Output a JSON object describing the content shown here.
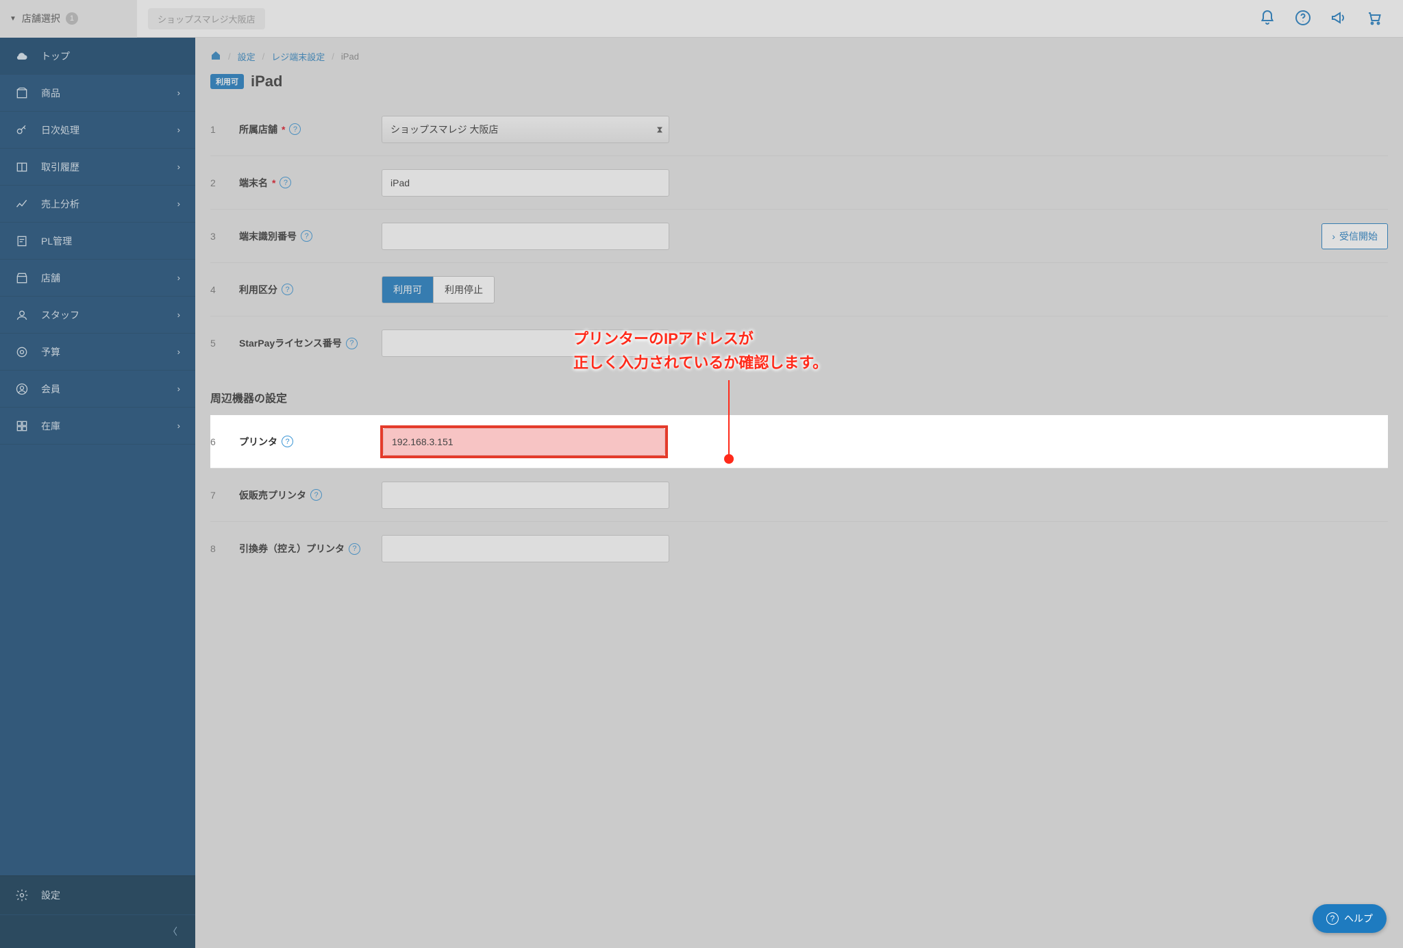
{
  "topbar": {
    "store_selector_label": "店舗選択",
    "store_count": "1",
    "store_name": "ショップスマレジ大阪店"
  },
  "breadcrumbs": {
    "b1": "設定",
    "b2": "レジ端末設定",
    "b3": "iPad"
  },
  "page": {
    "usable_tag": "利用可",
    "title": "iPad"
  },
  "sidebar": {
    "top": "トップ",
    "products": "商品",
    "daily": "日次処理",
    "history": "取引履歴",
    "sales": "売上分析",
    "pl": "PL管理",
    "stores": "店舗",
    "staff": "スタッフ",
    "budget": "予算",
    "members": "会員",
    "stock": "在庫",
    "settings": "設定"
  },
  "form": {
    "r1_num": "1",
    "r1_label": "所属店舗",
    "r1_value": "ショップスマレジ 大阪店",
    "r2_num": "2",
    "r2_label": "端末名",
    "r2_value": "iPad",
    "r3_num": "3",
    "r3_label": "端末識別番号",
    "r3_value": "",
    "r3_btn": "受信開始",
    "r4_num": "4",
    "r4_label": "利用区分",
    "r4_opt_on": "利用可",
    "r4_opt_off": "利用停止",
    "r5_num": "5",
    "r5_label": "StarPayライセンス番号",
    "r5_value": "",
    "section_peripherals": "周辺機器の設定",
    "r6_num": "6",
    "r6_label": "プリンタ",
    "r6_value": "192.168.3.151",
    "r7_num": "7",
    "r7_label": "仮販売プリンタ",
    "r7_value": "",
    "r8_num": "8",
    "r8_label": "引換券（控え）プリンタ",
    "r8_value": ""
  },
  "annotation": {
    "line1": "プリンターのIPアドレスが",
    "line2": "正しく入力されているか確認します。"
  },
  "help_fab": "ヘルプ"
}
